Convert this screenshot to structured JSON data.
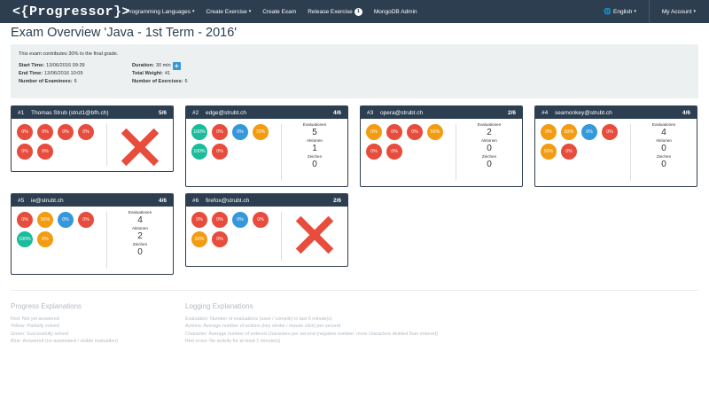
{
  "nav": {
    "brand": "<{Progressor}>",
    "items": [
      {
        "label": "Programming Languages",
        "dropdown": true
      },
      {
        "label": "Create Exercise",
        "dropdown": true
      },
      {
        "label": "Create Exam",
        "dropdown": false
      },
      {
        "label": "Release Exercise",
        "dropdown": false,
        "badge": "1"
      },
      {
        "label": "MongoDB Admin",
        "dropdown": false
      }
    ],
    "language": "English",
    "account": "My Account",
    "caret": "▾",
    "globe": "🌐"
  },
  "page_title": "Exam Overview 'Java - 1st Term - 2016'",
  "info": {
    "description": "This exam contributes 30% to the final grade.",
    "start_label": "Start Time:",
    "start_value": "13/06/2016 09:39",
    "end_label": "End Time:",
    "end_value": "13/06/2016 10:09",
    "examinees_label": "Number of Examinees:",
    "examinees_value": "6",
    "duration_label": "Duration:",
    "duration_value": "30 min",
    "duration_button": "+",
    "weight_label": "Total Weight:",
    "weight_value": "41",
    "exercises_label": "Number of Exercises:",
    "exercises_value": "6"
  },
  "colors": {
    "red": "#e74c3c",
    "yellow": "#f39c12",
    "green": "#1abc9c",
    "blue": "#3498db",
    "header": "#2c3e50"
  },
  "stat_labels": {
    "evaluations": "Evaluationen",
    "actions": "Aktionen",
    "chars": "Zeichen"
  },
  "cards": [
    {
      "num": "#1",
      "name": "Thomas Strub (strut1@bfh.ch)",
      "score": "5/6",
      "circles": [
        {
          "v": "0%",
          "c": "red"
        },
        {
          "v": "0%",
          "c": "red"
        },
        {
          "v": "0%",
          "c": "red"
        },
        {
          "v": "0%",
          "c": "red"
        },
        {
          "v": "0%",
          "c": "red"
        },
        {
          "v": "0%",
          "c": "red"
        }
      ],
      "inactive": true
    },
    {
      "num": "#2",
      "name": "edge@strubt.ch",
      "score": "4/6",
      "circles": [
        {
          "v": "100%",
          "c": "green"
        },
        {
          "v": "0%",
          "c": "red"
        },
        {
          "v": "0%",
          "c": "blue"
        },
        {
          "v": "70%",
          "c": "yellow"
        },
        {
          "v": "100%",
          "c": "green"
        },
        {
          "v": "0%",
          "c": "red"
        }
      ],
      "inactive": false,
      "evaluations": "5",
      "actions": "1",
      "chars": "0"
    },
    {
      "num": "#3",
      "name": "opera@strubt.ch",
      "score": "2/6",
      "circles": [
        {
          "v": "0%",
          "c": "yellow"
        },
        {
          "v": "0%",
          "c": "red"
        },
        {
          "v": "0%",
          "c": "red"
        },
        {
          "v": "50%",
          "c": "yellow"
        },
        {
          "v": "0%",
          "c": "red"
        },
        {
          "v": "0%",
          "c": "red"
        }
      ],
      "inactive": false,
      "evaluations": "2",
      "actions": "0",
      "chars": "0"
    },
    {
      "num": "#4",
      "name": "seamonkey@strubt.ch",
      "score": "4/6",
      "circles": [
        {
          "v": "0%",
          "c": "yellow"
        },
        {
          "v": "83%",
          "c": "yellow"
        },
        {
          "v": "0%",
          "c": "blue"
        },
        {
          "v": "0%",
          "c": "red"
        },
        {
          "v": "50%",
          "c": "yellow"
        },
        {
          "v": "0%",
          "c": "red"
        }
      ],
      "inactive": false,
      "evaluations": "4",
      "actions": "0",
      "chars": "0"
    },
    {
      "num": "#5",
      "name": "ie@strubt.ch",
      "score": "4/6",
      "circles": [
        {
          "v": "0%",
          "c": "red"
        },
        {
          "v": "50%",
          "c": "yellow"
        },
        {
          "v": "0%",
          "c": "blue"
        },
        {
          "v": "0%",
          "c": "red"
        },
        {
          "v": "100%",
          "c": "green"
        },
        {
          "v": "0%",
          "c": "yellow"
        }
      ],
      "inactive": false,
      "evaluations": "4",
      "actions": "2",
      "chars": "0"
    },
    {
      "num": "#6",
      "name": "firefox@strubt.ch",
      "score": "2/6",
      "circles": [
        {
          "v": "0%",
          "c": "red"
        },
        {
          "v": "0%",
          "c": "red"
        },
        {
          "v": "0%",
          "c": "blue"
        },
        {
          "v": "0%",
          "c": "red"
        },
        {
          "v": "50%",
          "c": "yellow"
        },
        {
          "v": "0%",
          "c": "red"
        }
      ],
      "inactive": true
    }
  ],
  "progress_explanations": {
    "title": "Progress Explanations",
    "lines": [
      "Red: Not yet answered",
      "Yellow: Partially solved",
      "Green: Successfully solved",
      "Blue: Answered (no automated / visible evaluation)"
    ]
  },
  "logging_explanations": {
    "title": "Logging Explanations",
    "lines": [
      "Evaluation: Number of evaluations (save / compile) in last 5 minute(s)",
      "Actions: Average number of actions (key stroke / mouse click) per second",
      "Character: Average number of entered characters per second (negative number: more characters deleted than entered)",
      "Red cross: No activity for at least 1 minute(s)"
    ]
  }
}
